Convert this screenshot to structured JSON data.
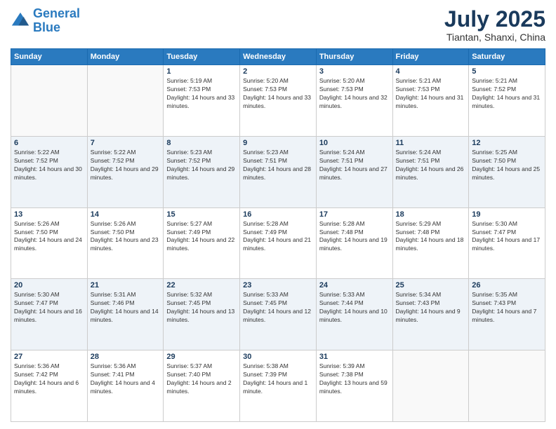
{
  "header": {
    "logo_line1": "General",
    "logo_line2": "Blue",
    "month": "July 2025",
    "location": "Tiantan, Shanxi, China"
  },
  "days_of_week": [
    "Sunday",
    "Monday",
    "Tuesday",
    "Wednesday",
    "Thursday",
    "Friday",
    "Saturday"
  ],
  "weeks": [
    [
      {
        "day": "",
        "empty": true
      },
      {
        "day": "",
        "empty": true
      },
      {
        "day": "1",
        "sunrise": "5:19 AM",
        "sunset": "7:53 PM",
        "daylight": "14 hours and 33 minutes."
      },
      {
        "day": "2",
        "sunrise": "5:20 AM",
        "sunset": "7:53 PM",
        "daylight": "14 hours and 33 minutes."
      },
      {
        "day": "3",
        "sunrise": "5:20 AM",
        "sunset": "7:53 PM",
        "daylight": "14 hours and 32 minutes."
      },
      {
        "day": "4",
        "sunrise": "5:21 AM",
        "sunset": "7:53 PM",
        "daylight": "14 hours and 31 minutes."
      },
      {
        "day": "5",
        "sunrise": "5:21 AM",
        "sunset": "7:52 PM",
        "daylight": "14 hours and 31 minutes."
      }
    ],
    [
      {
        "day": "6",
        "sunrise": "5:22 AM",
        "sunset": "7:52 PM",
        "daylight": "14 hours and 30 minutes."
      },
      {
        "day": "7",
        "sunrise": "5:22 AM",
        "sunset": "7:52 PM",
        "daylight": "14 hours and 29 minutes."
      },
      {
        "day": "8",
        "sunrise": "5:23 AM",
        "sunset": "7:52 PM",
        "daylight": "14 hours and 29 minutes."
      },
      {
        "day": "9",
        "sunrise": "5:23 AM",
        "sunset": "7:51 PM",
        "daylight": "14 hours and 28 minutes."
      },
      {
        "day": "10",
        "sunrise": "5:24 AM",
        "sunset": "7:51 PM",
        "daylight": "14 hours and 27 minutes."
      },
      {
        "day": "11",
        "sunrise": "5:24 AM",
        "sunset": "7:51 PM",
        "daylight": "14 hours and 26 minutes."
      },
      {
        "day": "12",
        "sunrise": "5:25 AM",
        "sunset": "7:50 PM",
        "daylight": "14 hours and 25 minutes."
      }
    ],
    [
      {
        "day": "13",
        "sunrise": "5:26 AM",
        "sunset": "7:50 PM",
        "daylight": "14 hours and 24 minutes."
      },
      {
        "day": "14",
        "sunrise": "5:26 AM",
        "sunset": "7:50 PM",
        "daylight": "14 hours and 23 minutes."
      },
      {
        "day": "15",
        "sunrise": "5:27 AM",
        "sunset": "7:49 PM",
        "daylight": "14 hours and 22 minutes."
      },
      {
        "day": "16",
        "sunrise": "5:28 AM",
        "sunset": "7:49 PM",
        "daylight": "14 hours and 21 minutes."
      },
      {
        "day": "17",
        "sunrise": "5:28 AM",
        "sunset": "7:48 PM",
        "daylight": "14 hours and 19 minutes."
      },
      {
        "day": "18",
        "sunrise": "5:29 AM",
        "sunset": "7:48 PM",
        "daylight": "14 hours and 18 minutes."
      },
      {
        "day": "19",
        "sunrise": "5:30 AM",
        "sunset": "7:47 PM",
        "daylight": "14 hours and 17 minutes."
      }
    ],
    [
      {
        "day": "20",
        "sunrise": "5:30 AM",
        "sunset": "7:47 PM",
        "daylight": "14 hours and 16 minutes."
      },
      {
        "day": "21",
        "sunrise": "5:31 AM",
        "sunset": "7:46 PM",
        "daylight": "14 hours and 14 minutes."
      },
      {
        "day": "22",
        "sunrise": "5:32 AM",
        "sunset": "7:45 PM",
        "daylight": "14 hours and 13 minutes."
      },
      {
        "day": "23",
        "sunrise": "5:33 AM",
        "sunset": "7:45 PM",
        "daylight": "14 hours and 12 minutes."
      },
      {
        "day": "24",
        "sunrise": "5:33 AM",
        "sunset": "7:44 PM",
        "daylight": "14 hours and 10 minutes."
      },
      {
        "day": "25",
        "sunrise": "5:34 AM",
        "sunset": "7:43 PM",
        "daylight": "14 hours and 9 minutes."
      },
      {
        "day": "26",
        "sunrise": "5:35 AM",
        "sunset": "7:43 PM",
        "daylight": "14 hours and 7 minutes."
      }
    ],
    [
      {
        "day": "27",
        "sunrise": "5:36 AM",
        "sunset": "7:42 PM",
        "daylight": "14 hours and 6 minutes."
      },
      {
        "day": "28",
        "sunrise": "5:36 AM",
        "sunset": "7:41 PM",
        "daylight": "14 hours and 4 minutes."
      },
      {
        "day": "29",
        "sunrise": "5:37 AM",
        "sunset": "7:40 PM",
        "daylight": "14 hours and 2 minutes."
      },
      {
        "day": "30",
        "sunrise": "5:38 AM",
        "sunset": "7:39 PM",
        "daylight": "14 hours and 1 minute."
      },
      {
        "day": "31",
        "sunrise": "5:39 AM",
        "sunset": "7:38 PM",
        "daylight": "13 hours and 59 minutes."
      },
      {
        "day": "",
        "empty": true
      },
      {
        "day": "",
        "empty": true
      }
    ]
  ]
}
